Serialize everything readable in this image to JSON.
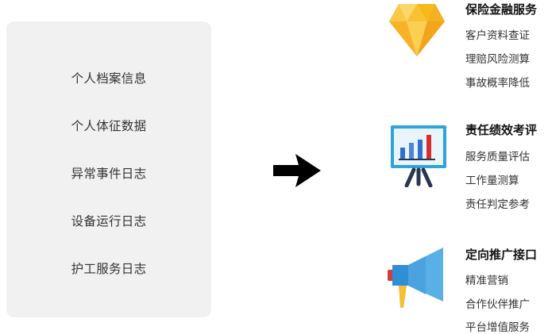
{
  "data_sources": {
    "items": [
      "个人档案信息",
      "个人体征数据",
      "异常事件日志",
      "设备运行日志",
      "护工服务日志"
    ]
  },
  "services": [
    {
      "title": "保险金融服务",
      "icon": "diamond-icon",
      "items": [
        "客户资料查证",
        "理赔风险测算",
        "事故概率降低"
      ]
    },
    {
      "title": "责任绩效考评",
      "icon": "presentation-chart-icon",
      "items": [
        "服务质量评估",
        "工作量测算",
        "责任判定参考"
      ]
    },
    {
      "title": "定向推广接口",
      "icon": "megaphone-icon",
      "items": [
        "精准营销",
        "合作伙伴推广",
        "平台增值服务"
      ]
    }
  ],
  "colors": {
    "panel_bg": "#f1f1f1",
    "arrow": "#000000",
    "diamond": "#f9c234",
    "chart_blue": "#2f6fd1",
    "chart_red": "#d32f2f",
    "megaphone": "#5ab0e6"
  }
}
